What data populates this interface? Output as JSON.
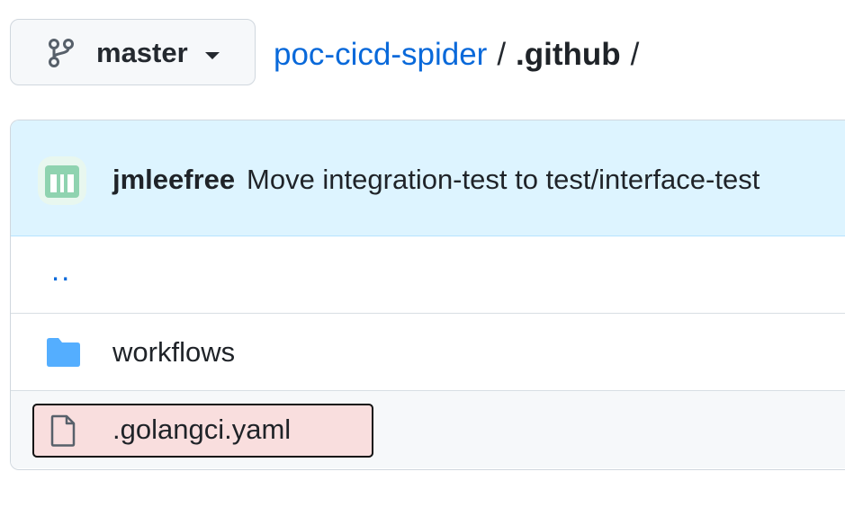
{
  "branch": {
    "name": "master",
    "icon": "git-branch-icon"
  },
  "breadcrumb": {
    "repo": "poc-cicd-spider",
    "separator": "/",
    "directory": ".github",
    "trailing_separator": "/"
  },
  "commit": {
    "author": "jmleefree",
    "message": "Move integration-test to test/interface-test",
    "avatar_color": "#8fd3b0"
  },
  "files": {
    "parent_link": "..",
    "items": [
      {
        "name": "workflows",
        "type": "directory",
        "icon": "folder-icon"
      },
      {
        "name": ".golangci.yaml",
        "type": "file",
        "icon": "file-icon",
        "highlighted": true
      }
    ]
  },
  "colors": {
    "link": "#0969da",
    "folder": "#54aeff",
    "commit_bar": "#ddf4ff",
    "highlight_fill": "#f9dede"
  }
}
